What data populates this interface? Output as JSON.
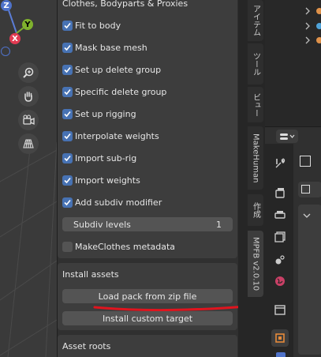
{
  "viewport": {
    "gizmo": {
      "z_label": "Z",
      "y_label": "Y",
      "x_label": "X"
    },
    "nav_tools": [
      "zoom-icon",
      "hand-icon",
      "camera-icon",
      "grid-icon"
    ]
  },
  "sidebar": {
    "clothes_section": {
      "title": "Clothes, Bodyparts & Proxies",
      "options": [
        {
          "label": "Fit to body",
          "checked": true
        },
        {
          "label": "Mask base mesh",
          "checked": true
        },
        {
          "label": "Set up delete group",
          "checked": true
        },
        {
          "label": "Specific delete group",
          "checked": true
        },
        {
          "label": "Set up rigging",
          "checked": true
        },
        {
          "label": "Interpolate weights",
          "checked": true
        },
        {
          "label": "Import sub-rig",
          "checked": true
        },
        {
          "label": "Import weights",
          "checked": true
        },
        {
          "label": "Add subdiv modifier",
          "checked": true
        }
      ],
      "subdiv": {
        "label": "Subdiv levels",
        "value": "1"
      },
      "metadata": {
        "label": "MakeClothes metadata",
        "checked": false
      }
    },
    "install_section": {
      "title": "Install assets",
      "load_pack": "Load pack from zip file",
      "install_target": "Install custom target"
    },
    "asset_roots": {
      "title": "Asset roots"
    }
  },
  "tabs": [
    "アイテム",
    "ツール",
    "ビュー",
    "MakeHuman",
    "作成",
    "MPFB v2.0.10"
  ],
  "colors": {
    "checkbox_on": "#4772b3",
    "highlight_underline": "#e0141e",
    "accent": "#4772b3"
  }
}
